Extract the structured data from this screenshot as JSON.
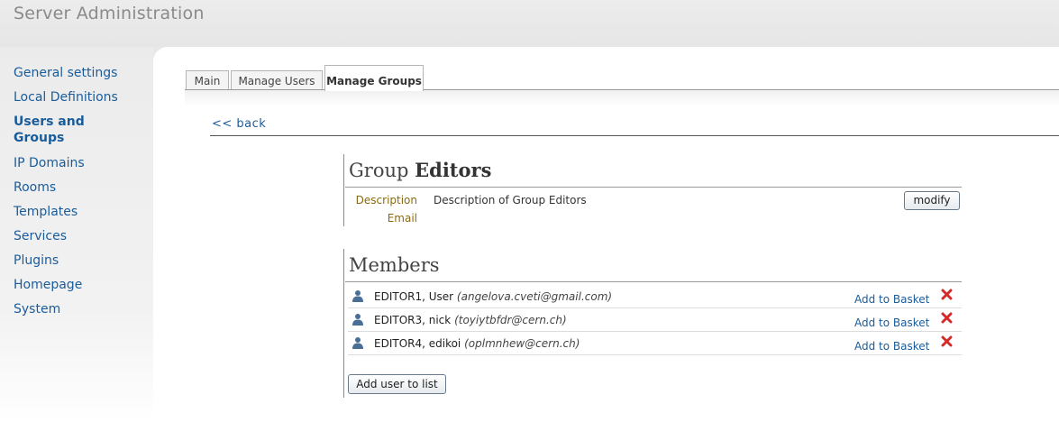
{
  "header": {
    "title": "Server Administration"
  },
  "sidebar": {
    "items": [
      {
        "label": "General settings"
      },
      {
        "label": "Local Definitions"
      },
      {
        "label": "Users and Groups"
      },
      {
        "label": "IP Domains"
      },
      {
        "label": "Rooms"
      },
      {
        "label": "Templates"
      },
      {
        "label": "Services"
      },
      {
        "label": "Plugins"
      },
      {
        "label": "Homepage"
      },
      {
        "label": "System"
      }
    ],
    "active_index": 2
  },
  "tabs": [
    {
      "label": "Main"
    },
    {
      "label": "Manage Users"
    },
    {
      "label": "Manage Groups"
    }
  ],
  "active_tab": "Manage Groups",
  "back_label": "<< back",
  "group": {
    "title_prefix": "Group",
    "name": "Editors",
    "description_label": "Description",
    "description": "Description of Group Editors",
    "email_label": "Email",
    "email": "",
    "modify_label": "modify"
  },
  "members": {
    "title": "Members",
    "rows": [
      {
        "name": "EDITOR1, User",
        "email": "(angelova.cveti@gmail.com)",
        "action": "Add to Basket"
      },
      {
        "name": "EDITOR3, nick",
        "email": "(toyiytbfdr@cern.ch)",
        "action": "Add to Basket"
      },
      {
        "name": "EDITOR4, edikoi",
        "email": "(oplmnhew@cern.ch)",
        "action": "Add to Basket"
      }
    ],
    "add_label": "Add user to list"
  },
  "colors": {
    "link": "#1a5c9a",
    "label": "#8a6a10",
    "remove": "#d42a2a",
    "user_icon": "#4a6f96"
  },
  "icons": {
    "member": "user-icon",
    "remove": "remove-icon"
  }
}
